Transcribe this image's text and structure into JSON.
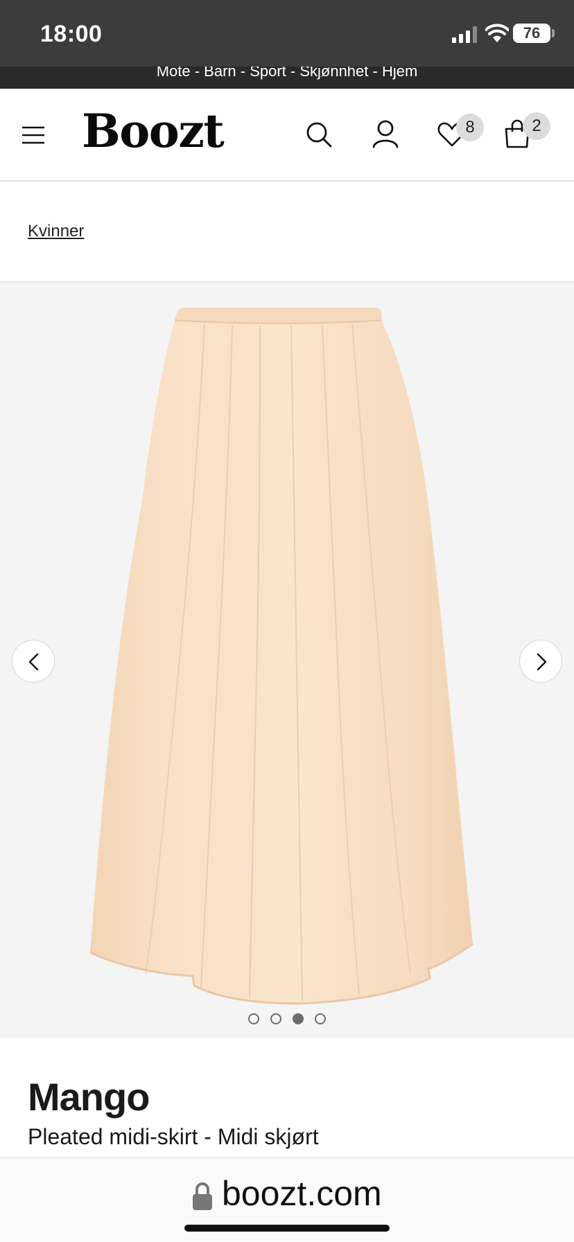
{
  "status_bar": {
    "time": "18:00",
    "battery": "76"
  },
  "promo": {
    "text": "Mote - Barn - Sport - Skjønnhet - Hjem"
  },
  "header": {
    "logo": "Boozt",
    "wishlist_count": "8",
    "cart_count": "2",
    "icons": [
      "menu-icon",
      "search-icon",
      "user-icon",
      "heart-icon",
      "shopping-bag-icon"
    ]
  },
  "breadcrumb": {
    "link": "Kvinner"
  },
  "gallery": {
    "image_count": 4,
    "active_index": 2,
    "product_color": "#f7dcc0",
    "background": "#f4f4f4"
  },
  "product": {
    "brand": "Mango",
    "name": "Pleated midi-skirt - Midi skjørt"
  },
  "browser": {
    "url": "boozt.com"
  }
}
